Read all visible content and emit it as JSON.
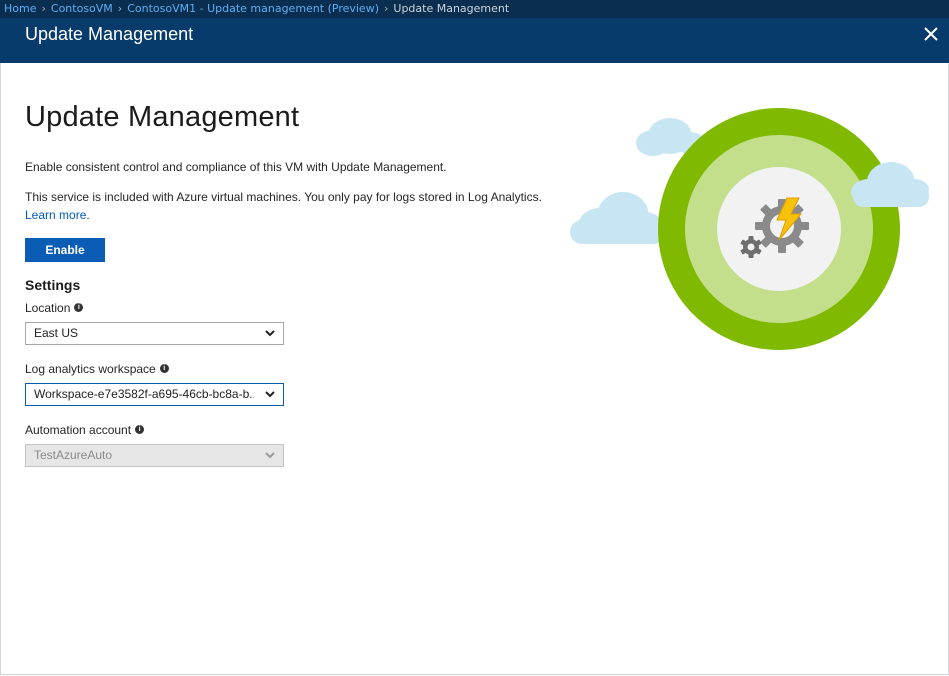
{
  "breadcrumb": {
    "items": [
      "Home",
      "ContosoVM",
      "ContosoVM1 - Update management (Preview)"
    ],
    "current": "Update Management"
  },
  "blade": {
    "title": "Update Management"
  },
  "main": {
    "heading": "Update Management",
    "description_1": "Enable consistent control and compliance of this VM with Update Management.",
    "description_2": "This service is included with Azure virtual machines. You only pay for logs stored in Log Analytics.",
    "learn_more": "Learn more.",
    "enable_label": "Enable"
  },
  "settings": {
    "heading": "Settings",
    "location": {
      "label": "Location",
      "value": "East US"
    },
    "workspace": {
      "label": "Log analytics workspace",
      "value": "Workspace-e7e3582f-a695-46cb-bc8a-b..."
    },
    "automation": {
      "label": "Automation account",
      "value": "TestAzureAuto"
    }
  },
  "icons": {
    "close": "close-icon",
    "info": "info-icon",
    "chevron": "chevron-down-icon",
    "illustration": "update-management-illustration"
  },
  "colors": {
    "header": "#073b6b",
    "breadcrumb_bar": "#0a2e4f",
    "accent_button": "#0b5cb4",
    "ring_outer": "#7fba00",
    "ring_inner": "#c3df8c"
  }
}
